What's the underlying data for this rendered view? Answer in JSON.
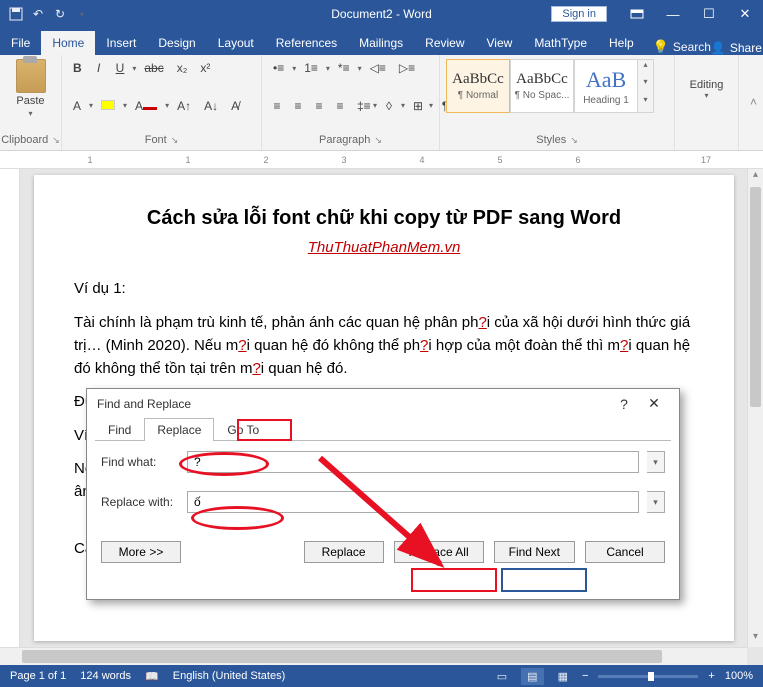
{
  "titlebar": {
    "title": "Document2  -  Word",
    "signin": "Sign in"
  },
  "tabs": {
    "file": "File",
    "home": "Home",
    "insert": "Insert",
    "design": "Design",
    "layout": "Layout",
    "references": "References",
    "mailings": "Mailings",
    "review": "Review",
    "view": "View",
    "mathtype": "MathType",
    "help": "Help",
    "search": "Search",
    "share": "Share"
  },
  "ribbon": {
    "paste": "Paste",
    "clipboard": "Clipboard",
    "font": "Font",
    "paragraph": "Paragraph",
    "styles_label": "Styles",
    "editing": "Editing",
    "styles": [
      {
        "preview": "AaBbCc",
        "name": "¶ Normal"
      },
      {
        "preview": "AaBbCc",
        "name": "¶ No Spac..."
      },
      {
        "preview": "AaB",
        "name": "Heading 1"
      }
    ]
  },
  "document": {
    "title": "Cách sửa lỗi font chữ khi copy từ PDF sang Word",
    "subtitle": "ThuThuatPhanMem.vn",
    "p1": "Ví dụ 1:",
    "p2a": "Tài chính là phạm trù kinh tế, phản ánh các quan hệ phân ph",
    "p2b": "i của xã hội dưới hình thức giá trị… (Minh 2020). Nếu m",
    "p2c": "i quan hệ đó không thể ph",
    "p2d": "i hợp của một đoàn thể thì m",
    "p2e": "i quan hệ đó không thể tồn tại trên m",
    "p2f": "i quan hệ đó.",
    "q": "?",
    "p3": "Được",
    "p4": "Ví dụ",
    "p5a": "Nếu b",
    "p5b": "ân loại l",
    "p6": "Câu n"
  },
  "dialog": {
    "title": "Find and Replace",
    "tab_find": "Find",
    "tab_replace": "Replace",
    "tab_goto": "Go To",
    "find_what": "Find what:",
    "find_value": "?",
    "replace_with": "Replace with:",
    "replace_value": "ố",
    "more": "More >>",
    "replace": "Replace",
    "replace_all": "Replace All",
    "find_next": "Find Next",
    "cancel": "Cancel"
  },
  "statusbar": {
    "page": "Page 1 of 1",
    "words": "124 words",
    "lang": "English (United States)",
    "zoom": "100%"
  }
}
